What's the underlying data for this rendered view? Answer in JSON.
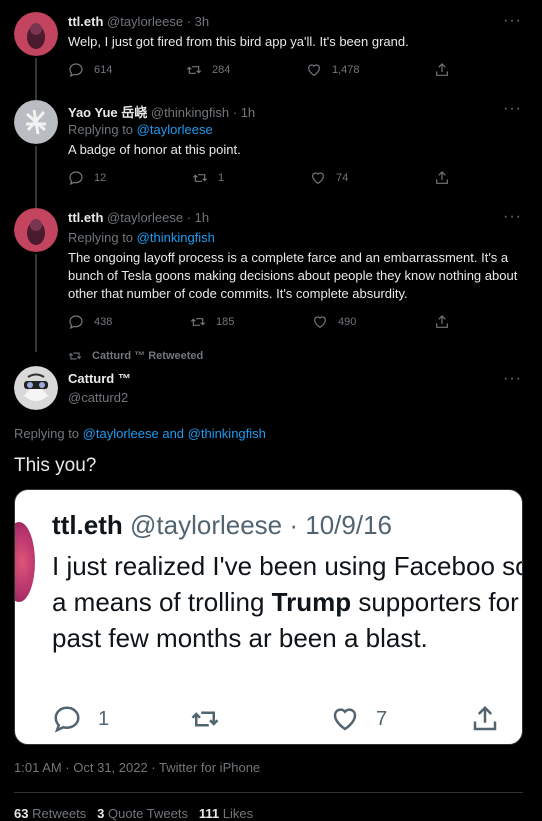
{
  "tweets": [
    {
      "name": "ttl.eth",
      "handle": "@taylorleese",
      "time": "· 3h",
      "text": "Welp, I just got fired from this bird app ya'll. It's been grand.",
      "replies": "614",
      "retweets": "284",
      "likes": "1,478"
    },
    {
      "name": "Yao Yue 岳峣",
      "handle": "@thinkingfish",
      "time": "· 1h",
      "replying_label": "Replying to",
      "replying_to": "@taylorleese",
      "text": "A badge of honor at this point.",
      "replies": "12",
      "retweets": "1",
      "likes": "74"
    },
    {
      "name": "ttl.eth",
      "handle": "@taylorleese",
      "time": "· 1h",
      "replying_label": "Replying to",
      "replying_to": "@thinkingfish",
      "text": "The ongoing layoff process is a complete farce and an embarrassment. It's a bunch of Tesla goons making decisions about people they know nothing about other that number of code commits. It's complete absurdity.",
      "replies": "438",
      "retweets": "185",
      "likes": "490"
    }
  ],
  "main": {
    "retweeted_by": "Catturd ™ Retweeted",
    "name": "Catturd ™",
    "handle": "@catturd2",
    "replying_label": "Replying to",
    "replying_to": "@taylorleese and @thinkingfish",
    "text": "This you?",
    "timestamp": "1:01 AM · Oct 31, 2022 · Twitter for iPhone",
    "stats": {
      "retweets": "63",
      "retweets_label": "Retweets",
      "quotes": "3",
      "quotes_label": "Quote Tweets",
      "likes": "111",
      "likes_label": "Likes"
    }
  },
  "embedded": {
    "name": "ttl.eth",
    "handle": "@taylorleese",
    "date": "· 10/9/16",
    "text_before": "I just realized I've been using Faceboo solely as a means of trolling ",
    "text_bold": "Trump",
    "text_after": " supporters for the past few months ar been a blast.",
    "replies": "1",
    "likes": "7"
  },
  "colors": {
    "background": "#000000",
    "text": "#e7e9ea",
    "muted": "#71767b",
    "link": "#1d9bf0"
  }
}
